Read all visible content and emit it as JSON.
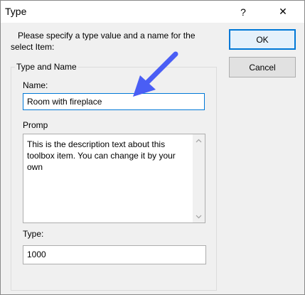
{
  "window": {
    "title": "Type",
    "help_glyph": "?",
    "close_glyph": "✕"
  },
  "instruction": {
    "line1": "Please specify a type value and a name for the",
    "line2": "select Item:"
  },
  "group": {
    "legend": "Type and Name"
  },
  "fields": {
    "name_label": "Name:",
    "name_value": "Room with fireplace",
    "promp_label": "Promp",
    "promp_value": "This is the description text  about this toolbox item. You can change it by your own",
    "type_label": "Type:",
    "type_value": "1000"
  },
  "buttons": {
    "ok_label": "OK",
    "cancel_label": "Cancel"
  },
  "colors": {
    "focus": "#0078d7",
    "annotation_arrow": "#4a5ef5"
  },
  "icons": {
    "help": "help-icon",
    "close": "close-icon",
    "scroll_up": "chevron-up-icon",
    "scroll_down": "chevron-down-icon",
    "arrow": "annotation-arrow-icon"
  }
}
